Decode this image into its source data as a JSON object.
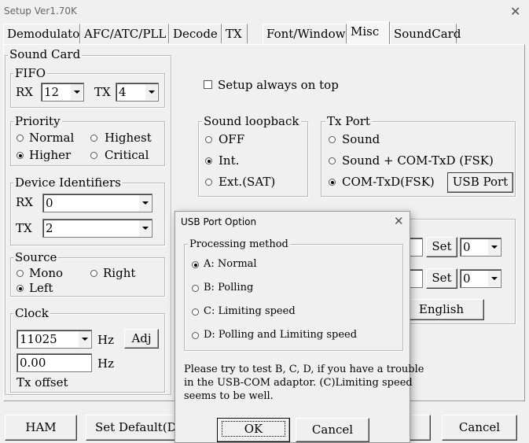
{
  "window": {
    "title": "Setup Ver1.70K",
    "close_glyph": "✕"
  },
  "tabs": [
    "Demodulator",
    "AFC/ATC/PLL",
    "Decode",
    "TX",
    "Font/Window",
    "Misc",
    "SoundCard"
  ],
  "sound_card": {
    "label": "Sound Card",
    "fifo": {
      "label": "FIFO",
      "rx_label": "RX",
      "rx_value": "12",
      "tx_label": "TX",
      "tx_value": "4"
    },
    "priority": {
      "label": "Priority",
      "normal": "Normal",
      "highest": "Highest",
      "higher": "Higher",
      "critical": "Critical"
    },
    "device_identifiers": {
      "label": "Device Identifiers",
      "rx_label": "RX",
      "rx_value": "0",
      "tx_label": "TX",
      "tx_value": "2"
    },
    "source": {
      "label": "Source",
      "mono": "Mono",
      "right": "Right",
      "left": "Left"
    },
    "clock": {
      "label": "Clock",
      "value": "11025",
      "unit": "Hz",
      "adj_button": "Adj",
      "tx_offset_value": "0.00",
      "tx_offset_unit": "Hz",
      "tx_offset_label": "Tx offset"
    }
  },
  "setup_always_on_top": "Setup always on top",
  "sound_loopback": {
    "label": "Sound loopback",
    "off": "OFF",
    "int": "Int.",
    "ext": "Ext.(SAT)"
  },
  "tx_port": {
    "label": "Tx Port",
    "sound": "Sound",
    "sound_com": "Sound + COM-TxD (FSK)",
    "com": "COM-TxD(FSK)",
    "usb_port_button": "USB Port"
  },
  "right_panel": {
    "set1": "Set",
    "combo1": "0",
    "set2": "Set",
    "combo2": "0",
    "language_button": "English"
  },
  "bottom": {
    "ham_button": "HAM",
    "set_default_button": "Set Default(De",
    "cancel_button": "Cancel"
  },
  "usb_dialog": {
    "title": "USB Port Option",
    "close_glyph": "✕",
    "processing_label": "Processing method",
    "options": [
      "A: Normal",
      "B: Polling",
      "C: Limiting speed",
      "D: Polling and Limiting speed"
    ],
    "selected": "A: Normal",
    "note_line1": "Please try to test B, C, D, if you have a trouble",
    "note_line2": "in the USB-COM adaptor. (C)Limiting speed",
    "note_line3": "seems to be well.",
    "ok_button": "OK",
    "cancel_button": "Cancel"
  }
}
